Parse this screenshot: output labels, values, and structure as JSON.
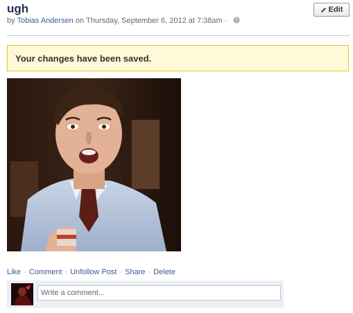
{
  "post": {
    "title": "ugh",
    "by_prefix": "by",
    "author": "Tobias Andersen",
    "date_text": "on Thursday, September 6, 2012 at 7:38am ·",
    "privacy_icon": "globe-icon"
  },
  "toolbar": {
    "edit_label": "Edit",
    "edit_icon": "pencil-icon"
  },
  "notice": {
    "message": "Your changes have been saved."
  },
  "actions": {
    "like": "Like",
    "comment": "Comment",
    "unfollow": "Unfollow Post",
    "share": "Share",
    "delete": "Delete",
    "separator": "·"
  },
  "comment": {
    "placeholder": "Write a comment..."
  },
  "colors": {
    "link": "#3b5998",
    "title": "#1e2d4f",
    "notice_bg": "#fff9d7",
    "notice_border": "#e2c822",
    "comment_bg": "#edeff4"
  }
}
